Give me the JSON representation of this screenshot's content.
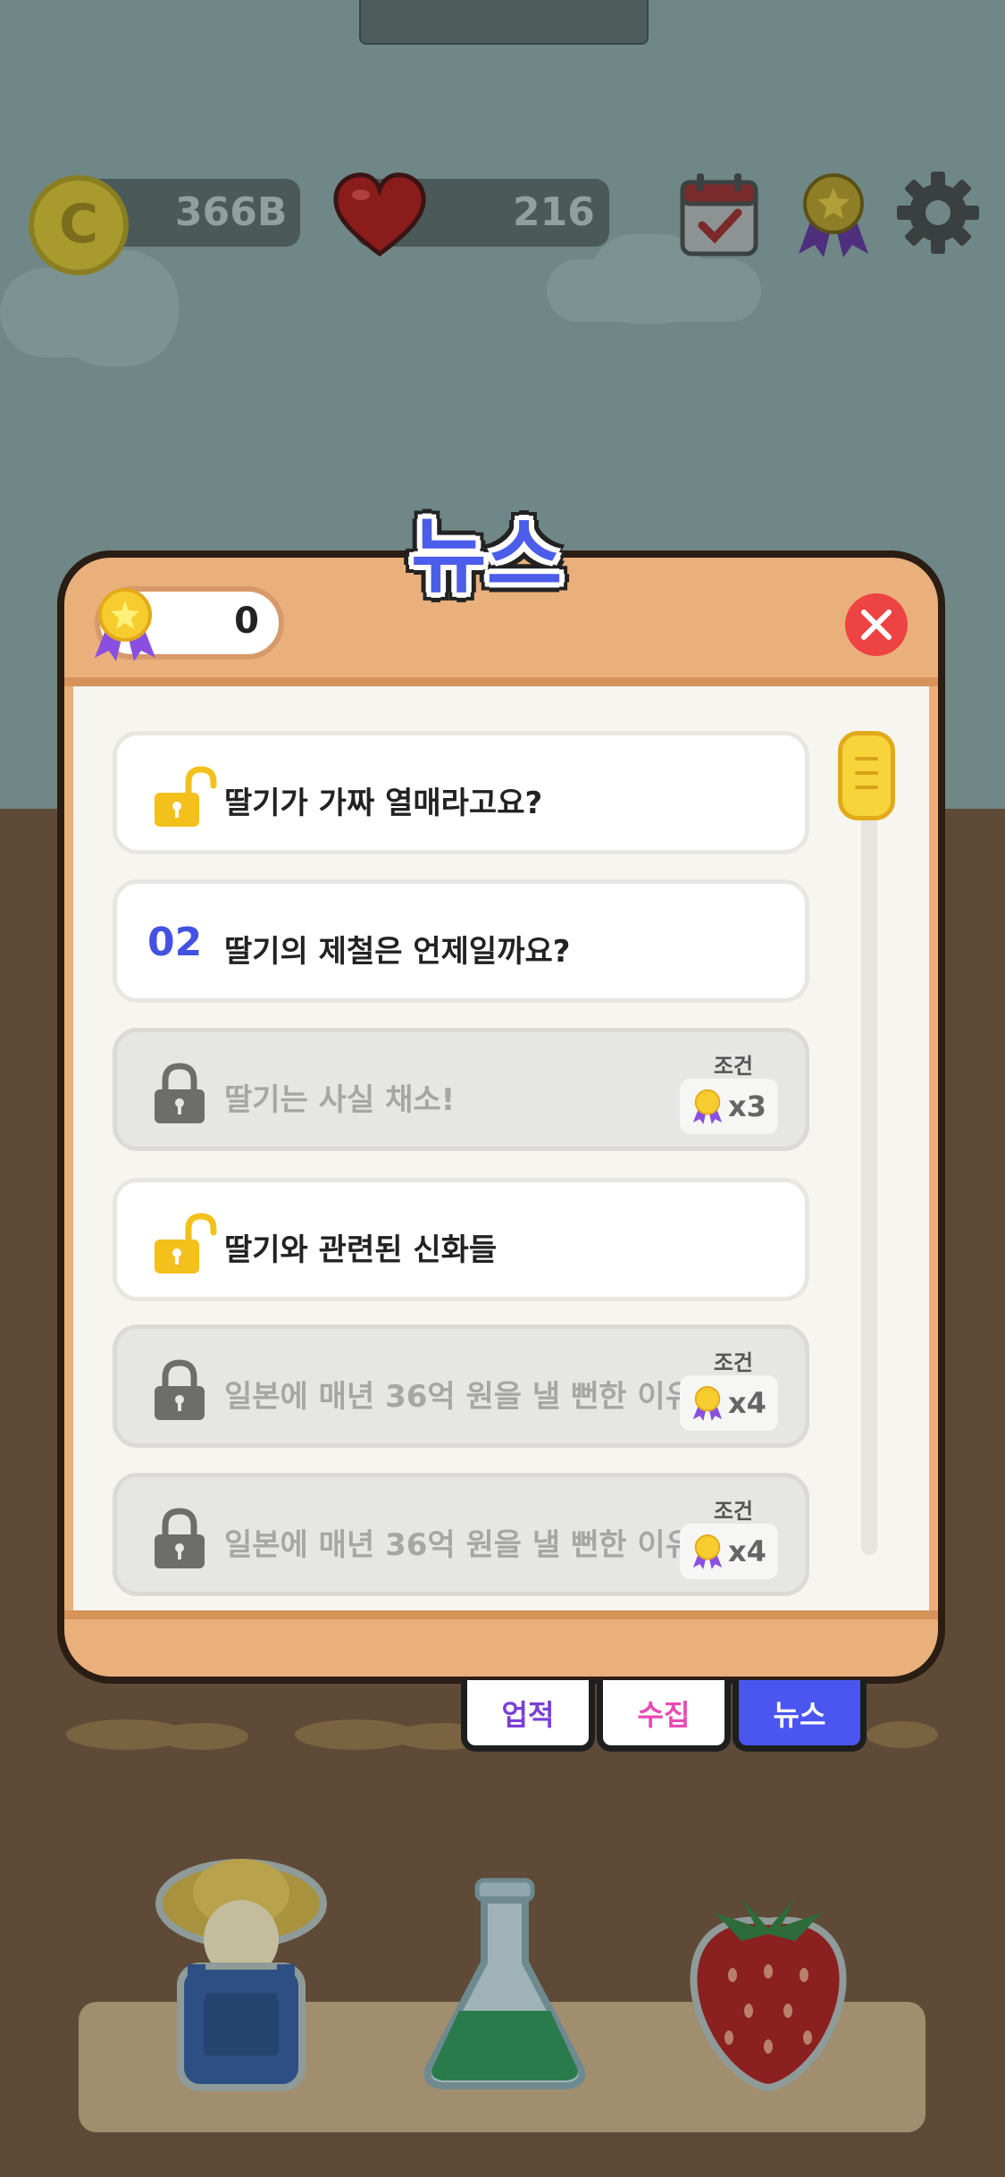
{
  "hud": {
    "coins": "366B",
    "hearts": "216",
    "coin_symbol": "C"
  },
  "dialog": {
    "title": "뉴스",
    "medal_count": "0"
  },
  "news_items": [
    {
      "state": "unlocked",
      "icon": "unlocked-padlock-icon",
      "title": "딸기가 가짜 열매라고요?"
    },
    {
      "state": "read",
      "number": "02",
      "title": "딸기의 제철은 언제일까요?"
    },
    {
      "state": "locked",
      "icon": "padlock-icon",
      "title": "딸기는 사실 채소!",
      "condition_label": "조건",
      "requirement": "x3"
    },
    {
      "state": "unlocked",
      "icon": "unlocked-padlock-icon",
      "title": "딸기와 관련된 신화들"
    },
    {
      "state": "locked",
      "icon": "padlock-icon",
      "title": "일본에 매년 36억 원을 낼 뻔한 이유",
      "condition_label": "조건",
      "requirement": "x4"
    },
    {
      "state": "locked",
      "icon": "padlock-icon",
      "title": "일본에 매년 36억 원을 낼 뻔한 이유",
      "condition_label": "조건",
      "requirement": "x4"
    }
  ],
  "tabs": [
    {
      "label": "업적",
      "active": false
    },
    {
      "label": "수집",
      "active": false
    },
    {
      "label": "뉴스",
      "active": true
    }
  ],
  "colors": {
    "accent_blue": "#4a56ef",
    "panel_orange": "#e9b07c",
    "close_red": "#ee4343",
    "scroll_yellow": "#f7d43a"
  }
}
